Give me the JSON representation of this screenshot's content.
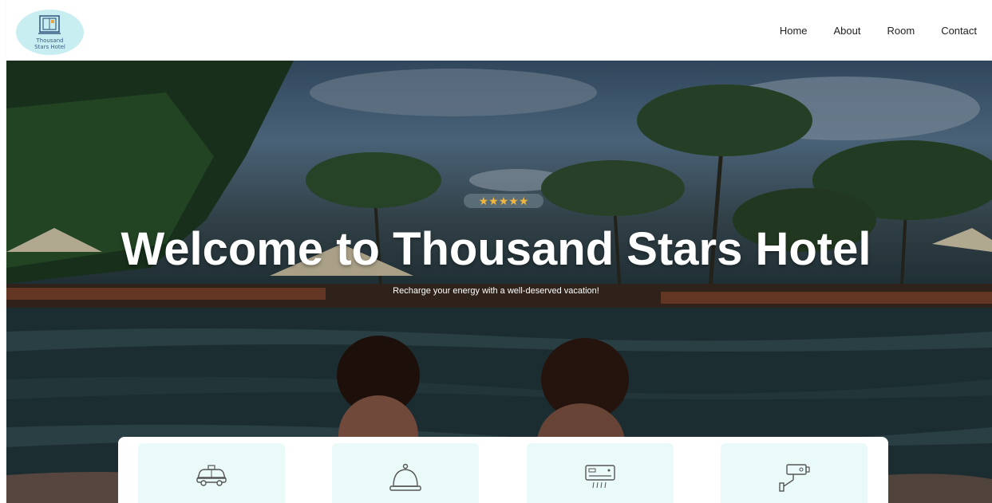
{
  "header": {
    "logo": {
      "line1": "Thousand",
      "line2": "Stars Hotel",
      "icon": "hotel-window-icon"
    },
    "nav": [
      {
        "label": "Home"
      },
      {
        "label": "About"
      },
      {
        "label": "Room"
      },
      {
        "label": "Contact"
      }
    ]
  },
  "hero": {
    "rating": "★★★★★",
    "star_color": "#f2b63c",
    "title": "Welcome to Thousand Stars Hotel",
    "subtitle": "Recharge your energy with a well-deserved vacation!"
  },
  "features": [
    {
      "icon": "taxi-icon"
    },
    {
      "icon": "reception-bell-icon"
    },
    {
      "icon": "air-conditioner-icon"
    },
    {
      "icon": "security-camera-icon"
    }
  ],
  "colors": {
    "accent": "#c9eef1",
    "card_background": "#eafaf9",
    "text": "#222222"
  }
}
